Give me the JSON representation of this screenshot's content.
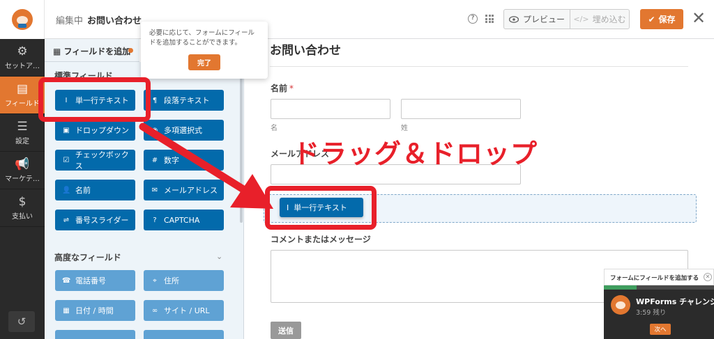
{
  "header": {
    "editing_label": "編集中",
    "form_name": "お問い合わせ",
    "preview_label": "プレビュー",
    "embed_label": "埋め込む",
    "save_label": "保存"
  },
  "nav": {
    "items": [
      {
        "label": "セットア…",
        "icon": "gear-icon"
      },
      {
        "label": "フィールド",
        "icon": "fields-icon"
      },
      {
        "label": "設定",
        "icon": "sliders-icon"
      },
      {
        "label": "マーケテ…",
        "icon": "megaphone-icon"
      },
      {
        "label": "支払い",
        "icon": "dollar-icon"
      }
    ]
  },
  "panel": {
    "add_fields_tab": "フィールドを追加",
    "standard_title": "標準フィールド",
    "standard_fields": [
      "単一行テキスト",
      "段落テキスト",
      "ドロップダウン",
      "多項選択式",
      "チェックボックス",
      "数字",
      "名前",
      "メールアドレス",
      "番号スライダー",
      "CAPTCHA"
    ],
    "advanced_title": "高度なフィールド",
    "advanced_fields": [
      "電話番号",
      "住所",
      "日付 / 時間",
      "サイト / URL"
    ]
  },
  "tooltip": {
    "text": "必要に応じて、フォームにフィールドを追加することができます。",
    "done_label": "完了"
  },
  "form": {
    "title": "お問い合わせ",
    "name_label": "名前",
    "required_mark": "*",
    "first_sub": "名",
    "last_sub": "姓",
    "email_label": "メールアドレス",
    "dragged_field": "単一行テキスト",
    "comment_label": "コメントまたはメッセージ",
    "submit_label": "送信"
  },
  "annotation": {
    "text": "ドラッグ＆ドロップ",
    "color": "#e8202a"
  },
  "challenge": {
    "header": "フォームにフィールドを追加する",
    "title": "WPForms チャレンジ",
    "time_left": "3:59 残り",
    "next_label": "次へ",
    "progress": 0.3
  },
  "colors": {
    "accent": "#e27730",
    "field_button": "#036aab",
    "advanced_button": "#5fa2d4"
  }
}
